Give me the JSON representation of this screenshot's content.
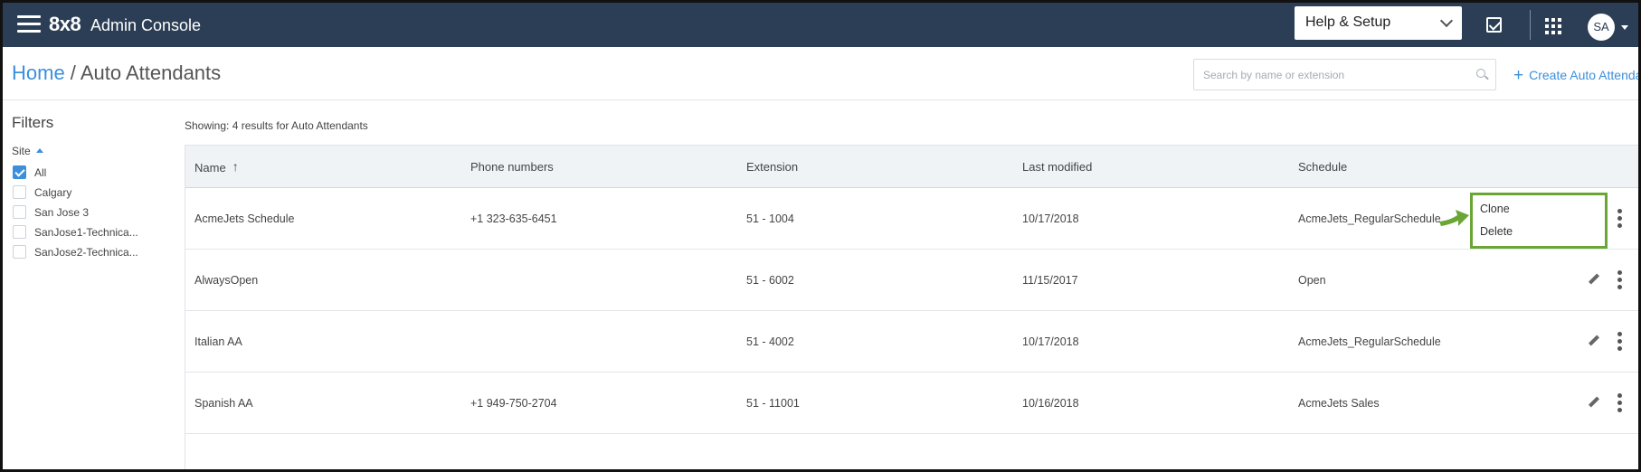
{
  "topbar": {
    "logo": "8x8",
    "app_title": "Admin Console",
    "help_select": "Help & Setup",
    "avatar_initials": "SA"
  },
  "header": {
    "breadcrumb_home": "Home",
    "breadcrumb_separator": " / ",
    "page_title": "Auto Attendants",
    "search_placeholder": "Search by name or extension",
    "create_label": "Create Auto Attendant"
  },
  "filters": {
    "title": "Filters",
    "group_label": "Site",
    "items": [
      {
        "label": "All",
        "checked": true
      },
      {
        "label": "Calgary",
        "checked": false
      },
      {
        "label": "San Jose 3",
        "checked": false
      },
      {
        "label": "SanJose1-Technica...",
        "checked": false
      },
      {
        "label": "SanJose2-Technica...",
        "checked": false
      }
    ]
  },
  "results": {
    "count_text": "Showing: 4 results for Auto Attendants"
  },
  "table": {
    "columns": [
      "Name",
      "Phone numbers",
      "Extension",
      "Last modified",
      "Schedule"
    ],
    "sort_column": "Name",
    "sort_direction": "ascending",
    "rows": [
      {
        "name": "AcmeJets Schedule",
        "phone": "+1 323-635-6451",
        "extension": "51 - 1004",
        "modified": "10/17/2018",
        "schedule": "AcmeJets_RegularSchedule"
      },
      {
        "name": "AlwaysOpen",
        "phone": "",
        "extension": "51 - 6002",
        "modified": "11/15/2017",
        "schedule": "Open"
      },
      {
        "name": "Italian AA",
        "phone": "",
        "extension": "51 - 4002",
        "modified": "10/17/2018",
        "schedule": "AcmeJets_RegularSchedule"
      },
      {
        "name": "Spanish AA",
        "phone": "+1 949-750-2704",
        "extension": "51 - 11001",
        "modified": "10/16/2018",
        "schedule": "AcmeJets Sales"
      }
    ]
  },
  "context_menu": {
    "items": [
      "Clone",
      "Delete"
    ]
  },
  "colors": {
    "topbar_bg": "#2c3e55",
    "accent_blue": "#3b8fdb",
    "highlight_green": "#6aa636",
    "table_header_bg": "#f0f3f6"
  },
  "icons": {
    "menu": "hamburger-icon",
    "tasks": "checkbox-tasks-icon",
    "apps": "apps-grid-icon",
    "search": "search-icon",
    "edit": "pencil-icon",
    "more": "kebab-icon"
  }
}
